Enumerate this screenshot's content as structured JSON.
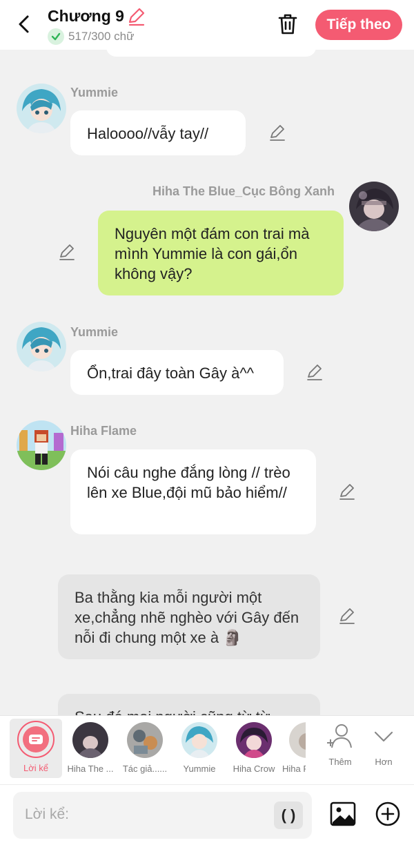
{
  "header": {
    "title": "Chương 9",
    "word_count": "517/300 chữ",
    "next_label": "Tiếp theo",
    "accent": "#f45b72"
  },
  "messages": [
    {
      "type": "char",
      "name": "Yummie",
      "text": "Haloooo//vẫy tay//"
    },
    {
      "type": "self",
      "name": "Hiha The Blue_Cục Bông Xanh",
      "text": "Nguyên một đám con trai mà mình Yummie là con gái,ổn không vậy?"
    },
    {
      "type": "char",
      "name": "Yummie",
      "text": "Ổn,trai đây toàn Gây à^^"
    },
    {
      "type": "char",
      "name": "Hiha Flame",
      "text": "Nói câu nghe đắng lòng // trèo lên xe Blue,đội mũ bảo hiểm//"
    },
    {
      "type": "narration",
      "text": "Ba thằng kia mỗi người một xe,chẳng nhẽ nghèo với Gây đến nỗi đi chung một xe à 🗿"
    },
    {
      "type": "narration",
      "text": "Sau đó mọi người cũng từ từ"
    }
  ],
  "characters": {
    "narrator_label": "Lời kể",
    "items": [
      {
        "label": "Hiha The ..."
      },
      {
        "label": "Tác giả......"
      },
      {
        "label": "Yummie"
      },
      {
        "label": "Hiha Crow"
      },
      {
        "label": "Hiha Fl"
      }
    ],
    "add_label": "Thêm",
    "more_label": "Hơn"
  },
  "input": {
    "placeholder": "Lời kể:",
    "paren_label": "( )"
  }
}
